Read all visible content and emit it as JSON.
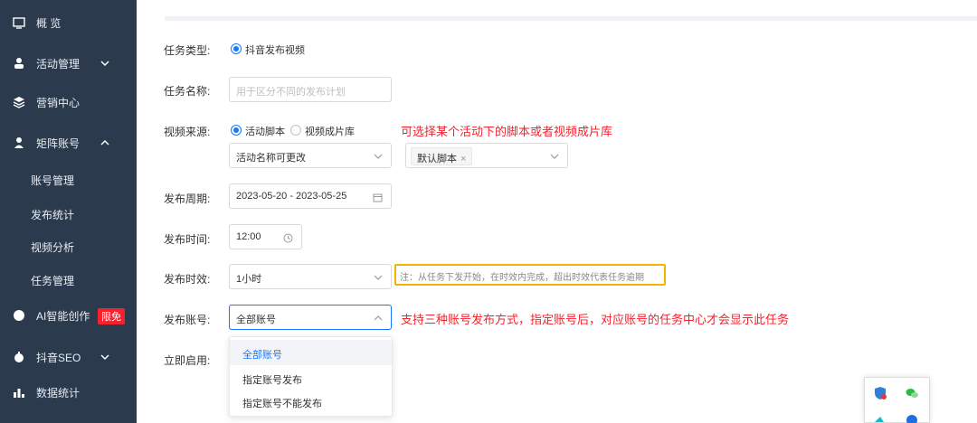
{
  "sidebar": {
    "overview": "概 览",
    "activity": "活动管理",
    "marketing": "营销中心",
    "matrix": "矩阵账号",
    "sub_items": [
      "账号管理",
      "发布统计",
      "视频分析",
      "任务管理"
    ],
    "ai": "AI智能创作",
    "ai_badge": "限免",
    "seo": "抖音SEO",
    "stats": "数据统计"
  },
  "form": {
    "task_type_label": "任务类型:",
    "task_type_option": "抖音发布视频",
    "task_name_label": "任务名称:",
    "task_name_placeholder": "用于区分不同的发布计划",
    "video_source_label": "视频来源:",
    "source_option_script": "活动脚本",
    "source_option_library": "视频成片库",
    "source_note": "可选择某个活动下的脚本或者视频成片库",
    "activity_select_value": "活动名称可更改",
    "script_tag": "默认脚本",
    "period_label": "发布周期:",
    "period_value": "2023-05-20 - 2023-05-25",
    "time_label": "发布时间:",
    "time_value": "12:00",
    "validity_label": "发布时效:",
    "validity_value": "1小时",
    "validity_note": "注：从任务下发开始，在时效内完成，超出时效代表任务逾期",
    "account_label": "发布账号:",
    "account_value": "全部账号",
    "account_note": "支持三种账号发布方式，指定账号后，对应账号的任务中心才会显示此任务",
    "enable_label": "立即启用:",
    "account_options": [
      "全部账号",
      "指定账号发布",
      "指定账号不能发布"
    ]
  },
  "colors": {
    "sidebar_bg": "#2b3a4d",
    "accent": "#1677ff",
    "note_red": "#f5222d",
    "warning_border": "#f5b400"
  }
}
